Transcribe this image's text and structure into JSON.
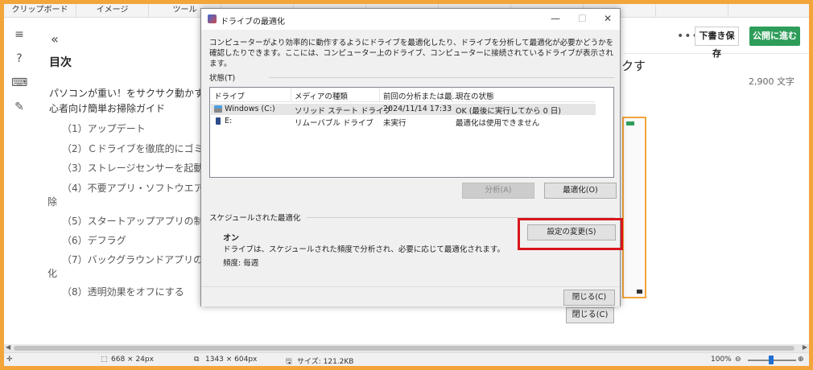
{
  "ribbon": {
    "tabs": [
      "クリップボード",
      "イメージ",
      "ツール",
      "",
      "",
      "",
      "",
      "",
      "",
      ""
    ]
  },
  "toc": {
    "title": "目次",
    "top_item": "パソコンが重い！をサクサク動かす！初心者向け簡単お掃除ガイド",
    "items": [
      "（1）アップデート",
      "（2）Ｃドライブを徹底的にゴミ削除",
      "（3）ストレージセンサーを起動",
      "（4）不要アプリ・ソフトウエアの削",
      "除",
      "（5）スタートアップアプリの制御",
      "（6）デフラグ",
      "（7）バックグラウンドアプリの無効",
      "化",
      "（8）透明効果をオフにする"
    ]
  },
  "editor": {
    "draft_label": "下書き保存",
    "publish_label": "公開に進む",
    "title_tail": "クす",
    "char_count": "2,900 文字",
    "bg_close_label": "閉じる(C)"
  },
  "dialog": {
    "title": "ドライブの最適化",
    "intro": "コンピューターがより効率的に動作するようにドライブを最適化したり、ドライブを分析して最適化が必要かどうかを確認したりできます。ここには、コンピューター上のドライブ、コンピューターに接続されているドライブが表示されます。",
    "status_label": "状態(T)",
    "columns": [
      "ドライブ",
      "メディアの種類",
      "前回の分析または最...",
      "現在の状態"
    ],
    "drives": [
      {
        "name": "Windows (C:)",
        "media": "ソリッド ステート ドライブ",
        "last": "2024/11/14 17:33",
        "status": "OK (最後に実行してから 0 日)",
        "icon": "hdd-icon"
      },
      {
        "name": "E:",
        "media": "リムーバブル ドライブ",
        "last": "未実行",
        "status": "最適化は使用できません",
        "icon": "usb-drive-icon"
      }
    ],
    "analyze_label": "分析(A)",
    "optimize_label": "最適化(O)",
    "scheduled_label": "スケジュールされた最適化",
    "schedule_state": "オン",
    "schedule_desc": "ドライブは、スケジュールされた頻度で分析され、必要に応じて最適化されます。",
    "schedule_freq": "頻度: 毎週",
    "change_settings_label": "設定の変更(S)",
    "close_label": "閉じる(C)"
  },
  "statusbar": {
    "selection_size": "668 × 24px",
    "image_size": "1343 × 604px",
    "file_size": "サイズ: 121.2KB",
    "zoom": "100%"
  },
  "colors": {
    "accent_orange": "#f3a53a",
    "publish_green": "#2e9d5a",
    "highlight_red": "#d8151b"
  }
}
